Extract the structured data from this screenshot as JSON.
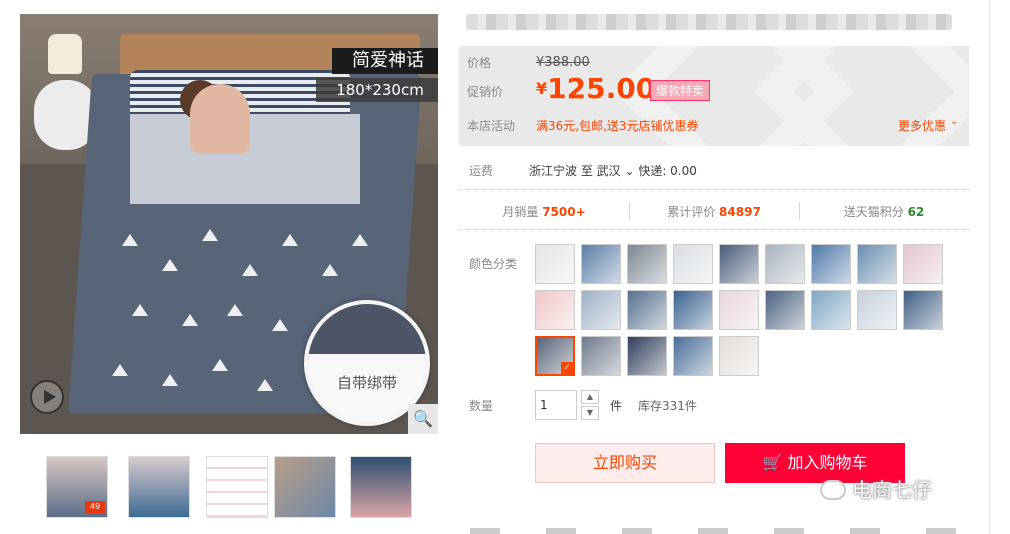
{
  "gallery": {
    "overlay_title": "简爱神话",
    "overlay_size": "180*230cm",
    "badge_text": "自带绑带",
    "thumb_badge": "爆款保障 49"
  },
  "price": {
    "price_label": "价格",
    "original": "¥388.00",
    "promo_label": "促销价",
    "currency": "¥",
    "promo": "125.00",
    "hot_tag": "爆款特卖",
    "store_label": "本店活动",
    "store_promo": "满36元,包邮,送3元店铺优惠券",
    "more_promo": "更多优惠"
  },
  "shipping": {
    "label": "运费",
    "text": "浙江宁波 至 武汉 ⌄ 快递: 0.00"
  },
  "stats": {
    "monthly_label": "月销量",
    "monthly_value": "7500+",
    "reviews_label": "累计评价",
    "reviews_value": "84897",
    "points_label": "送天猫积分",
    "points_value": "62"
  },
  "color": {
    "label": "颜色分类",
    "swatches": [
      {
        "color": "#e7e5e3",
        "sel": false
      },
      {
        "color": "#5b7fa6",
        "sel": false
      },
      {
        "color": "#7d8794",
        "sel": false
      },
      {
        "color": "#d9dde2",
        "sel": false
      },
      {
        "color": "#4a5c7a",
        "sel": false
      },
      {
        "color": "#a9b3c0",
        "sel": false
      },
      {
        "color": "#4f79a7",
        "sel": false
      },
      {
        "color": "#6a8fb0",
        "sel": false
      },
      {
        "color": "#e3c6d0",
        "sel": false
      },
      {
        "color": "#efc8c8",
        "sel": false
      },
      {
        "color": "#9fb2c7",
        "sel": false
      },
      {
        "color": "#56718f",
        "sel": false
      },
      {
        "color": "#39628e",
        "sel": false
      },
      {
        "color": "#e9d6dd",
        "sel": false
      },
      {
        "color": "#4c6380",
        "sel": false
      },
      {
        "color": "#7fa7c4",
        "sel": false
      },
      {
        "color": "#c6d1dc",
        "sel": false
      },
      {
        "color": "#3f5f84",
        "sel": false
      },
      {
        "color": "#5a6478",
        "sel": true
      },
      {
        "color": "#6e7b8d",
        "sel": false
      },
      {
        "color": "#2f3e5c",
        "sel": false
      },
      {
        "color": "#4a6f99",
        "sel": false
      },
      {
        "color": "#e4ddd8",
        "sel": false
      }
    ]
  },
  "quantity": {
    "label": "数量",
    "value": "1",
    "unit": "件",
    "stock": "库存331件"
  },
  "actions": {
    "buy_now": "立即购买",
    "add_cart": "加入购物车",
    "cart_icon": "cart-icon"
  },
  "watermark": "电商七仔"
}
